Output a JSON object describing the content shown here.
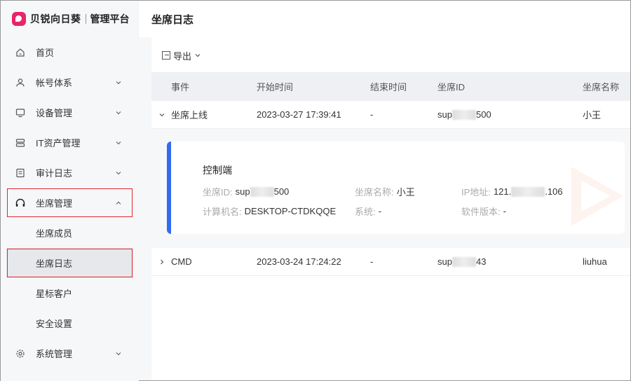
{
  "brand": {
    "name": "贝锐向日葵",
    "subtitle": "管理平台",
    "accent": "#e8246b"
  },
  "sidebar": {
    "items": [
      {
        "label": "首页",
        "icon": "home-icon"
      },
      {
        "label": "帐号体系",
        "icon": "user-icon"
      },
      {
        "label": "设备管理",
        "icon": "monitor-icon"
      },
      {
        "label": "IT资产管理",
        "icon": "server-icon"
      },
      {
        "label": "审计日志",
        "icon": "log-icon"
      },
      {
        "label": "坐席管理",
        "icon": "headset-icon"
      },
      {
        "label": "系统管理",
        "icon": "gear-icon"
      }
    ],
    "sub_items": [
      {
        "label": "坐席成员"
      },
      {
        "label": "坐席日志"
      },
      {
        "label": "星标客户"
      },
      {
        "label": "安全设置"
      }
    ]
  },
  "page": {
    "title": "坐席日志"
  },
  "toolbar": {
    "export_label": "导出"
  },
  "table": {
    "columns": [
      "事件",
      "开始时间",
      "结束时间",
      "坐席ID",
      "坐席名称"
    ],
    "rows": [
      {
        "event": "坐席上线",
        "start": "2023-03-27 17:39:41",
        "end": "-",
        "id_prefix": "sup",
        "id_suffix": "500",
        "name": "小王"
      },
      {
        "event": "CMD",
        "start": "2023-03-24 17:24:22",
        "end": "-",
        "id_prefix": "sup",
        "id_suffix": "43",
        "name": "liuhua"
      }
    ]
  },
  "detail": {
    "title": "控制端",
    "id_label": "坐席ID:",
    "id_prefix": "sup",
    "id_suffix": "500",
    "name_label": "坐席名称:",
    "name_value": "小王",
    "ip_label": "IP地址:",
    "ip_prefix": "121.",
    "ip_suffix": ".106",
    "computer_label": "计算机名:",
    "computer_value": "DESKTOP-CTDKQQE",
    "system_label": "系统:",
    "system_value": "-",
    "version_label": "软件版本:",
    "version_value": "-",
    "accent": "#2f6bf3"
  }
}
